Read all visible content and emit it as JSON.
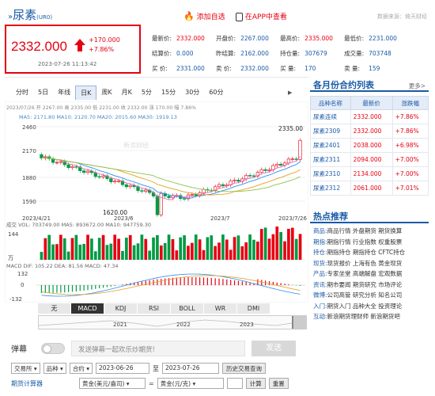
{
  "header": {
    "title": "尿素",
    "code": "(UR0)",
    "add_watch": "添加自选",
    "app_view": "在APP中查看",
    "source": "数据来源：倚天财经"
  },
  "quote": {
    "price": "2332.000",
    "change": "+170.000",
    "change_pct": "+7.86%",
    "timestamp": "2023-07-26 11:13:42"
  },
  "stats": [
    [
      {
        "label": "最新价:",
        "value": "2332.000",
        "color": "red"
      },
      {
        "label": "开盘价:",
        "value": "2267.000",
        "color": "blue"
      },
      {
        "label": "最高价:",
        "value": "2335.000",
        "color": "red"
      },
      {
        "label": "最低价:",
        "value": "2231.000",
        "color": "blue"
      }
    ],
    [
      {
        "label": "结算价:",
        "value": "0.000",
        "color": "blue"
      },
      {
        "label": "昨结算:",
        "value": "2162.000",
        "color": "blue"
      },
      {
        "label": "持仓量:",
        "value": "307679",
        "color": "blue"
      },
      {
        "label": "成交量:",
        "value": "703748",
        "color": "blue"
      }
    ],
    [
      {
        "label": "买  价:",
        "value": "2331.000",
        "color": "blue"
      },
      {
        "label": "卖  价:",
        "value": "2332.000",
        "color": "blue"
      },
      {
        "label": "买  量:",
        "value": "170",
        "color": "blue"
      },
      {
        "label": "卖  量:",
        "value": "159",
        "color": "blue"
      }
    ]
  ],
  "tabs": [
    "分时",
    "5日",
    "年线",
    "日K",
    "周K",
    "月K",
    "5分",
    "15分",
    "30分",
    "60分"
  ],
  "active_tab": "日K",
  "chart": {
    "info_line": "2023/07/26  开 2267.00  高 2335.00  低 2231.00  收 2332.00  涨 170.00  幅 7.86%",
    "ma_line": "MA5: 2171.80   MA10: 2120.70   MA20: 2015.60   MA30: 1919.13",
    "y_labels": [
      "2460",
      "2170",
      "1880",
      "1590"
    ],
    "high_label": "2335.00",
    "low_label": "1620.00",
    "x_labels": [
      "2023/4/21",
      "2023/6",
      "2023/7",
      "2023/7/26"
    ],
    "vol_line": "成交  VOL: 703749.00   MA5: 893672.00   MA10: 947759.30",
    "vol_labels": [
      "144",
      "万"
    ],
    "macd_line": "MACD  DIF: 105.22   DEA: 81.56   MACD: 47.34",
    "macd_labels": [
      "132",
      "0",
      "-132"
    ],
    "year_labels": [
      "2021",
      "2022",
      "2023"
    ],
    "watermark": "新浪财经"
  },
  "indicator_tabs": [
    "无",
    "MACD",
    "KDJ",
    "RSI",
    "BOLL",
    "WR",
    "DMI"
  ],
  "active_indicator": "MACD",
  "danmu": {
    "label": "弹幕",
    "placeholder": "发送弹幕一起欢乐炒期货!",
    "send": "发送"
  },
  "history": {
    "exchange": "交易所",
    "variety": "品种",
    "contract": "合约",
    "start": "2023-06-26",
    "to": "至",
    "end": "2023-07-26",
    "query": "历史交易查询"
  },
  "calculator": {
    "label": "期货计算器",
    "from": "黄金(美元/盎司)",
    "eq": "=",
    "to": "黄金(元/克)",
    "calc": "计算",
    "reset": "重置"
  },
  "contracts": {
    "title": "各月份合约列表",
    "more": "更多>",
    "headers": [
      "品种名称",
      "最新价",
      "涨跌幅"
    ],
    "rows": [
      {
        "name": "尿素连续",
        "price": "2332.000",
        "pct": "+7.86%"
      },
      {
        "name": "尿素2309",
        "price": "2332.000",
        "pct": "+7.86%"
      },
      {
        "name": "尿素2401",
        "price": "2038.000",
        "pct": "+6.98%"
      },
      {
        "name": "尿素2311",
        "price": "2094.000",
        "pct": "+7.00%"
      },
      {
        "name": "尿素2310",
        "price": "2134.000",
        "pct": "+7.00%"
      },
      {
        "name": "尿素2312",
        "price": "2061.000",
        "pct": "+7.01%"
      }
    ]
  },
  "hot": {
    "title": "热点推荐",
    "rows": [
      {
        "cat": "商品:",
        "items": "商品行情 外盘期货 期货换算"
      },
      {
        "cat": "期指:",
        "items": "期指行情 行业指数 权重股票"
      },
      {
        "cat": "持仓:",
        "items": "期指持仓 期指持仓 CFTC持仓"
      },
      {
        "cat": "现货:",
        "items": "现货报价 上海有色 黄金现货"
      },
      {
        "cat": "产品:",
        "items": "专家坐堂 高端解盘 宏观数据"
      },
      {
        "cat": "资讯:",
        "items": "期市要闻 期货研究 市场评论"
      },
      {
        "cat": "微博:",
        "items": "公司高管 研究分析 知名公司"
      },
      {
        "cat": "入门:",
        "items": "期货入门 品种大全 投资理论"
      },
      {
        "cat": "互动:",
        "items": "新浪期货理财师 新浪期货吧"
      }
    ]
  }
}
